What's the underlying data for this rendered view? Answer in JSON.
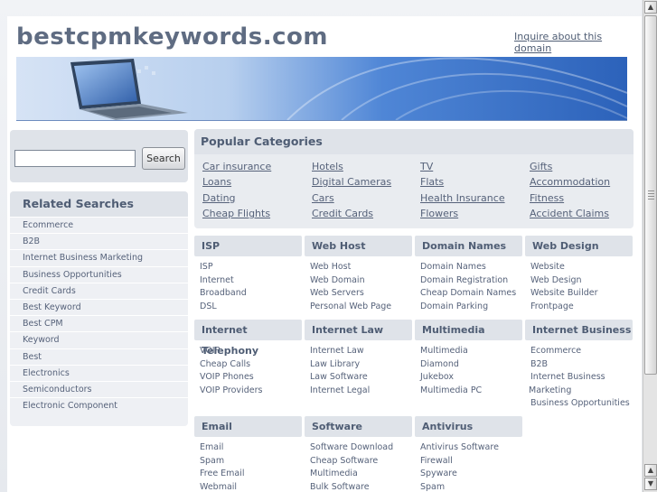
{
  "header": {
    "site_title": "bestcpmkeywords.com",
    "inquire_link": "Inquire about this domain"
  },
  "search": {
    "input_value": "",
    "button_label": "Search"
  },
  "related": {
    "title": "Related Searches",
    "items": [
      "Ecommerce",
      "B2B",
      "Internet Business Marketing",
      "Business Opportunities",
      "Credit Cards",
      "Best Keyword",
      "Best CPM",
      "Keyword",
      "Best",
      "Electronics",
      "Semiconductors",
      "Electronic Component"
    ]
  },
  "popular": {
    "title": "Popular Categories",
    "links": [
      [
        "Car insurance",
        "Hotels",
        "TV",
        "Gifts"
      ],
      [
        "Loans",
        "Digital Cameras",
        "Flats",
        "Accommodation"
      ],
      [
        "Dating",
        "Cars",
        "Health Insurance",
        "Fitness"
      ],
      [
        "Cheap Flights",
        "Credit Cards",
        "Flowers",
        "Accident Claims"
      ]
    ]
  },
  "categories": [
    {
      "title": "ISP",
      "links": [
        "ISP",
        "Internet",
        "Broadband",
        "DSL"
      ]
    },
    {
      "title": "Web Host",
      "links": [
        "Web Host",
        "Web Domain",
        "Web Servers",
        "Personal Web Page"
      ]
    },
    {
      "title": "Domain Names",
      "links": [
        "Domain Names",
        "Domain Registration",
        "Cheap Domain Names",
        "Domain Parking"
      ]
    },
    {
      "title": "Web Design",
      "links": [
        "Website",
        "Web Design",
        "Website Builder",
        "Frontpage"
      ]
    },
    {
      "title": "Internet Telephony",
      "links": [
        "VOIP",
        "Cheap Calls",
        "VOIP Phones",
        "VOIP Providers"
      ]
    },
    {
      "title": "Internet Law",
      "links": [
        "Internet Law",
        "Law Library",
        "Law Software",
        "Internet Legal"
      ]
    },
    {
      "title": "Multimedia",
      "links": [
        "Multimedia",
        "Diamond",
        "Jukebox",
        "Multimedia PC"
      ]
    },
    {
      "title": "Internet Business",
      "links": [
        "Ecommerce",
        "B2B",
        "Internet Business",
        "Marketing",
        "Business Opportunities"
      ]
    },
    {
      "title": "Email",
      "links": [
        "Email",
        "Spam",
        "Free Email",
        "Webmail"
      ]
    },
    {
      "title": "Software",
      "links": [
        "Software Download",
        "Cheap Software",
        "Multimedia",
        "Bulk Software"
      ]
    },
    {
      "title": "Antivirus",
      "links": [
        "Antivirus Software",
        "Firewall",
        "Spyware",
        "Spam"
      ]
    }
  ],
  "colors": {
    "accent": "#4f5d74",
    "panel": "#dfe3e9",
    "banner_blue": "#2c62ba"
  },
  "icons": {
    "scroll_up": "scroll-up-arrow-icon",
    "scroll_down": "scroll-down-arrow-icon"
  }
}
